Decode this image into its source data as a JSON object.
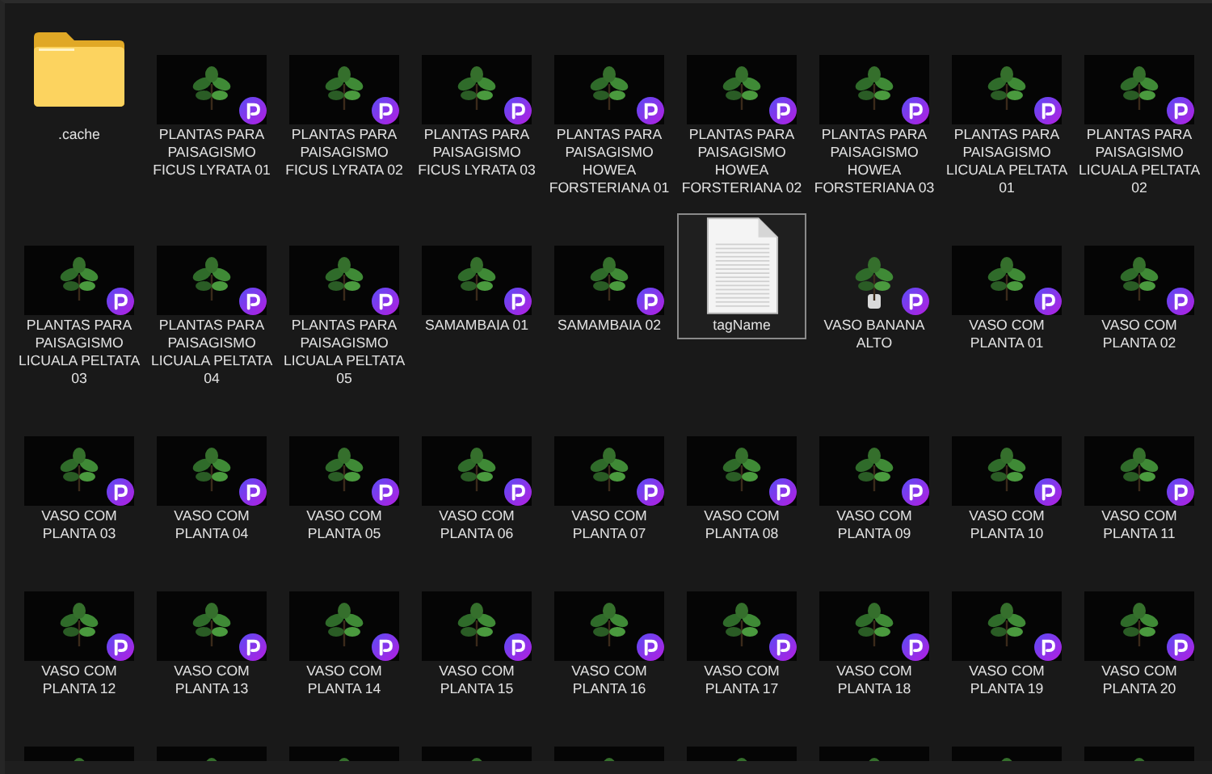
{
  "items": [
    {
      "kind": "folder",
      "name": ".cache",
      "selected": false
    },
    {
      "kind": "image",
      "name": "PLANTAS PARA PAISAGISMO FICUS LYRATA 01",
      "selected": false
    },
    {
      "kind": "image",
      "name": "PLANTAS PARA PAISAGISMO FICUS LYRATA 02",
      "selected": false
    },
    {
      "kind": "image",
      "name": "PLANTAS PARA PAISAGISMO FICUS LYRATA 03",
      "selected": false
    },
    {
      "kind": "image",
      "name": "PLANTAS PARA PAISAGISMO HOWEA FORSTERIANA 01",
      "selected": false
    },
    {
      "kind": "image",
      "name": "PLANTAS PARA PAISAGISMO HOWEA FORSTERIANA 02",
      "selected": false
    },
    {
      "kind": "image",
      "name": "PLANTAS PARA PAISAGISMO HOWEA FORSTERIANA 03",
      "selected": false
    },
    {
      "kind": "image",
      "name": "PLANTAS PARA PAISAGISMO LICUALA PELTATA 01",
      "selected": false
    },
    {
      "kind": "image",
      "name": "PLANTAS PARA PAISAGISMO LICUALA PELTATA 02",
      "selected": false
    },
    {
      "kind": "image",
      "name": "PLANTAS PARA PAISAGISMO LICUALA PELTATA 03",
      "selected": false
    },
    {
      "kind": "image",
      "name": "PLANTAS PARA PAISAGISMO LICUALA PELTATA 04",
      "selected": false
    },
    {
      "kind": "image",
      "name": "PLANTAS PARA PAISAGISMO LICUALA PELTATA 05",
      "selected": false
    },
    {
      "kind": "image",
      "name": "SAMAMBAIA 01",
      "selected": false
    },
    {
      "kind": "image",
      "name": "SAMAMBAIA 02",
      "selected": false
    },
    {
      "kind": "document",
      "name": "tagName",
      "selected": true
    },
    {
      "kind": "cutout",
      "name": "VASO BANANA ALTO",
      "selected": false
    },
    {
      "kind": "image",
      "name": "VASO COM PLANTA 01",
      "selected": false
    },
    {
      "kind": "image",
      "name": "VASO COM PLANTA 02",
      "selected": false
    },
    {
      "kind": "image",
      "name": "VASO COM PLANTA 03",
      "selected": false
    },
    {
      "kind": "image",
      "name": "VASO COM PLANTA 04",
      "selected": false
    },
    {
      "kind": "image",
      "name": "VASO COM PLANTA 05",
      "selected": false
    },
    {
      "kind": "image",
      "name": "VASO COM PLANTA 06",
      "selected": false
    },
    {
      "kind": "image",
      "name": "VASO COM PLANTA 07",
      "selected": false
    },
    {
      "kind": "image",
      "name": "VASO COM PLANTA 08",
      "selected": false
    },
    {
      "kind": "image",
      "name": "VASO COM PLANTA 09",
      "selected": false
    },
    {
      "kind": "image",
      "name": "VASO COM PLANTA 10",
      "selected": false
    },
    {
      "kind": "image",
      "name": "VASO COM PLANTA 11",
      "selected": false
    },
    {
      "kind": "image",
      "name": "VASO COM PLANTA 12",
      "selected": false
    },
    {
      "kind": "image",
      "name": "VASO COM PLANTA 13",
      "selected": false
    },
    {
      "kind": "image",
      "name": "VASO COM PLANTA 14",
      "selected": false
    },
    {
      "kind": "image",
      "name": "VASO COM PLANTA 15",
      "selected": false
    },
    {
      "kind": "image",
      "name": "VASO COM PLANTA 16",
      "selected": false
    },
    {
      "kind": "image",
      "name": "VASO COM PLANTA 17",
      "selected": false
    },
    {
      "kind": "image",
      "name": "VASO COM PLANTA 18",
      "selected": false
    },
    {
      "kind": "image",
      "name": "VASO COM PLANTA 19",
      "selected": false
    },
    {
      "kind": "image",
      "name": "VASO COM PLANTA 20",
      "selected": false
    },
    {
      "kind": "image",
      "selected": false
    },
    {
      "kind": "image",
      "selected": false
    },
    {
      "kind": "image",
      "selected": false
    },
    {
      "kind": "image",
      "selected": false
    },
    {
      "kind": "image",
      "selected": false
    },
    {
      "kind": "image",
      "selected": false
    },
    {
      "kind": "image",
      "selected": false
    },
    {
      "kind": "image",
      "selected": false
    },
    {
      "kind": "image",
      "selected": false
    }
  ]
}
